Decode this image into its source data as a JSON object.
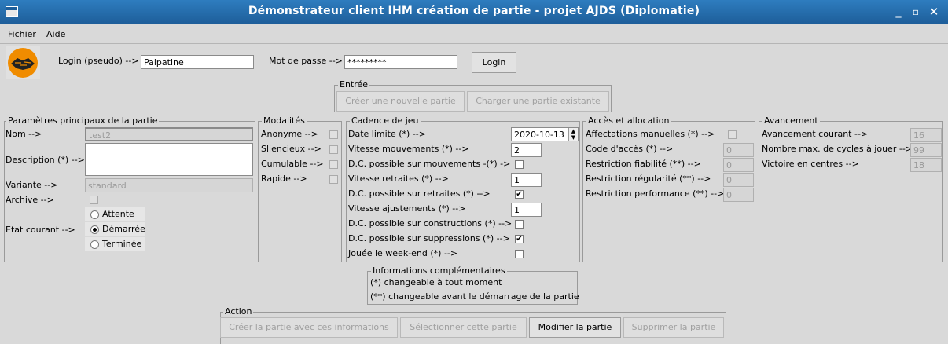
{
  "window": {
    "title": "Démonstrateur client IHM création de partie - projet AJDS (Diplomatie)"
  },
  "menu": {
    "fichier": "Fichier",
    "aide": "Aide"
  },
  "login": {
    "login_label": "Login (pseudo) -->",
    "login_value": "Palpatine",
    "password_label": "Mot de passe -->",
    "password_value": "*********",
    "login_button": "Login"
  },
  "entree": {
    "title": "Entrée",
    "new_game": "Créer une nouvelle partie",
    "load_game": "Charger une partie existante"
  },
  "params": {
    "title": "Paramètres principaux de la partie",
    "nom_label": "Nom -->",
    "nom_value": "test2",
    "description_label": "Description (*) -->",
    "description_value": "",
    "variante_label": "Variante -->",
    "variante_value": "standard",
    "archive_label": "Archive -->",
    "etat_label": "Etat courant -->",
    "etats": [
      "Attente",
      "Démarrée",
      "Terminée"
    ],
    "etat_selected": "Démarrée"
  },
  "modalites": {
    "title": "Modalités",
    "items": [
      "Anonyme -->",
      "Sliencieux -->",
      "Cumulable -->",
      "Rapide -->"
    ]
  },
  "cadence": {
    "title": "Cadence de jeu",
    "date_label": "Date limite (*) -->",
    "date_value": "2020-10-13",
    "vit_mouv_label": "Vitesse mouvements (*) -->",
    "vit_mouv_value": "2",
    "dc_mouv_label": "D.C. possible sur mouvements -(*) ->",
    "vit_retr_label": "Vitesse retraites (*) -->",
    "vit_retr_value": "1",
    "dc_retr_label": "D.C. possible sur retraites (*) -->",
    "vit_ajust_label": "Vitesse ajustements (*) -->",
    "vit_ajust_value": "1",
    "dc_constr_label": "D.C. possible sur constructions (*) -->",
    "dc_suppr_label": "D.C. possible sur suppressions (*) -->",
    "weekend_label": "Jouée le week-end (*) -->",
    "dc_mouv_checked": false,
    "dc_retr_checked": true,
    "dc_constr_checked": false,
    "dc_suppr_checked": true,
    "weekend_checked": false
  },
  "acces": {
    "title": "Accès et allocation",
    "affect_label": "Affectations manuelles (*) -->",
    "code_label": "Code d'accès (*) -->",
    "code_value": "0",
    "fiab_label": "Restriction fiabilité (**) -->",
    "fiab_value": "0",
    "regul_label": "Restriction régularité (**) -->",
    "regul_value": "0",
    "perf_label": "Restriction performance (**) -->",
    "perf_value": "0"
  },
  "avancement": {
    "title": "Avancement",
    "courant_label": "Avancement courant -->",
    "courant_value": "16",
    "cycles_label": "Nombre max. de cycles à jouer -->",
    "cycles_value": "99",
    "victoire_label": "Victoire en centres -->",
    "victoire_value": "18"
  },
  "infos": {
    "title": "Informations complémentaires",
    "line1": "(*) changeable à tout moment",
    "line2": "(**) changeable avant le démarrage de la partie"
  },
  "action": {
    "title": "Action",
    "create": "Créer la partie avec ces informations",
    "select": "Sélectionner cette partie",
    "modify": "Modifier la partie",
    "delete": "Supprimer la partie"
  },
  "colors": {
    "titlebar": "#1e5e9a",
    "background": "#d9d9d9",
    "logo": "#f08c00"
  }
}
